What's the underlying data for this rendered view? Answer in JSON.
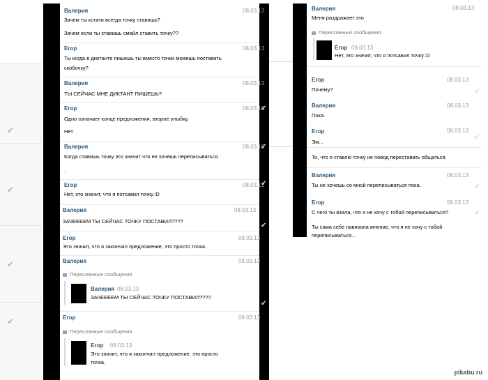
{
  "left": {
    "messages": [
      {
        "name": "Валерия",
        "date": "08.03.13",
        "lines": [
          "Зачем ты кстати всегда точку ставишь?",
          "Зачем если ты ставишь смайл ставить точку??"
        ]
      },
      {
        "name": "Егор",
        "date": "08.03.13",
        "lines": [
          "Ты когда в диктанте пишешь ты вместо точки можешь поставить",
          "скобочку?"
        ]
      },
      {
        "name": "Валерия",
        "date": "08.03.13",
        "lines": [
          "ТЫ СЕЙЧАС МНЕ ДИКТАНТ ПИШЕШЬ?"
        ]
      },
      {
        "name": "Егор",
        "date": "08.03.13",
        "lines": [
          "Одно означает конце предложения, второе улыбку.",
          "Нет."
        ]
      },
      {
        "name": "Валерия",
        "date": "08.03.13",
        "lines": [
          "Когда ставишь точку это значит что не хочешь переписываться",
          "."
        ]
      },
      {
        "name": "Егор",
        "date": "08.03.13",
        "lines": [
          "Нет, это значит, что я потсавил точку.:D"
        ]
      },
      {
        "name": "Валерия",
        "date": "08.03.13",
        "lines": [
          "ЗАЧЕЕЕЕМ ТЫ СЕЙЧАС ТОЧКУ ПОСТАВИЛ????"
        ]
      },
      {
        "name": "Егор",
        "date": "08.03.13",
        "lines": [
          "Это значит, что я закончил предложение, это просто точка."
        ]
      },
      {
        "name": "Валерия",
        "date": "08.03.13",
        "fwd_label": "Пересланные сообщения",
        "fwd_name": "Валерия",
        "fwd_date": "08.03.13",
        "fwd_text": "ЗАЧЕЕЕЕМ ТЫ СЕЙЧАС ТОЧКУ ПОСТАВИЛ????"
      },
      {
        "name": "Егор",
        "date": "08.03.13",
        "fwd_label": "Пересланные сообщения",
        "fwd_name": "Егор",
        "fwd_date": "08.03.13",
        "fwd_text_1": "Это значит, что я закончил предложение, это просто",
        "fwd_text_2": "точка."
      }
    ]
  },
  "right": {
    "top": {
      "name": "Валерия",
      "date": "08.03.13",
      "text": "Меня раздражает это",
      "fwd_label": "Пересланные сообщения",
      "fwd_name": "Егор",
      "fwd_date": "08.03.13",
      "fwd_text": "Нет, это значит, что я потсавил точку.:D"
    },
    "messages": [
      {
        "name": "Егор",
        "date": "08.03.13",
        "text": "Почему?"
      },
      {
        "name": "Валерия",
        "date": "08.03.13",
        "text": "Пока."
      },
      {
        "name": "Егор",
        "date": "08.03.13",
        "text": "Эм..."
      }
    ],
    "standalone": "То, что я ставлю точку не повод переставать общаться.",
    "messages2": [
      {
        "name": "Валерия",
        "date": "08.03.13",
        "text": "Ты не хочешь со мной переписываться пока."
      },
      {
        "name": "Егор",
        "date": "08.03.13",
        "text": "С чего ты взяла, что я не хочу с тобой переписываться?",
        "text2": "Ты сама себе навязала мнение, что я не хочу с тобой",
        "text3": "переписываться..."
      }
    ]
  },
  "watermark": "pikabu.ru"
}
